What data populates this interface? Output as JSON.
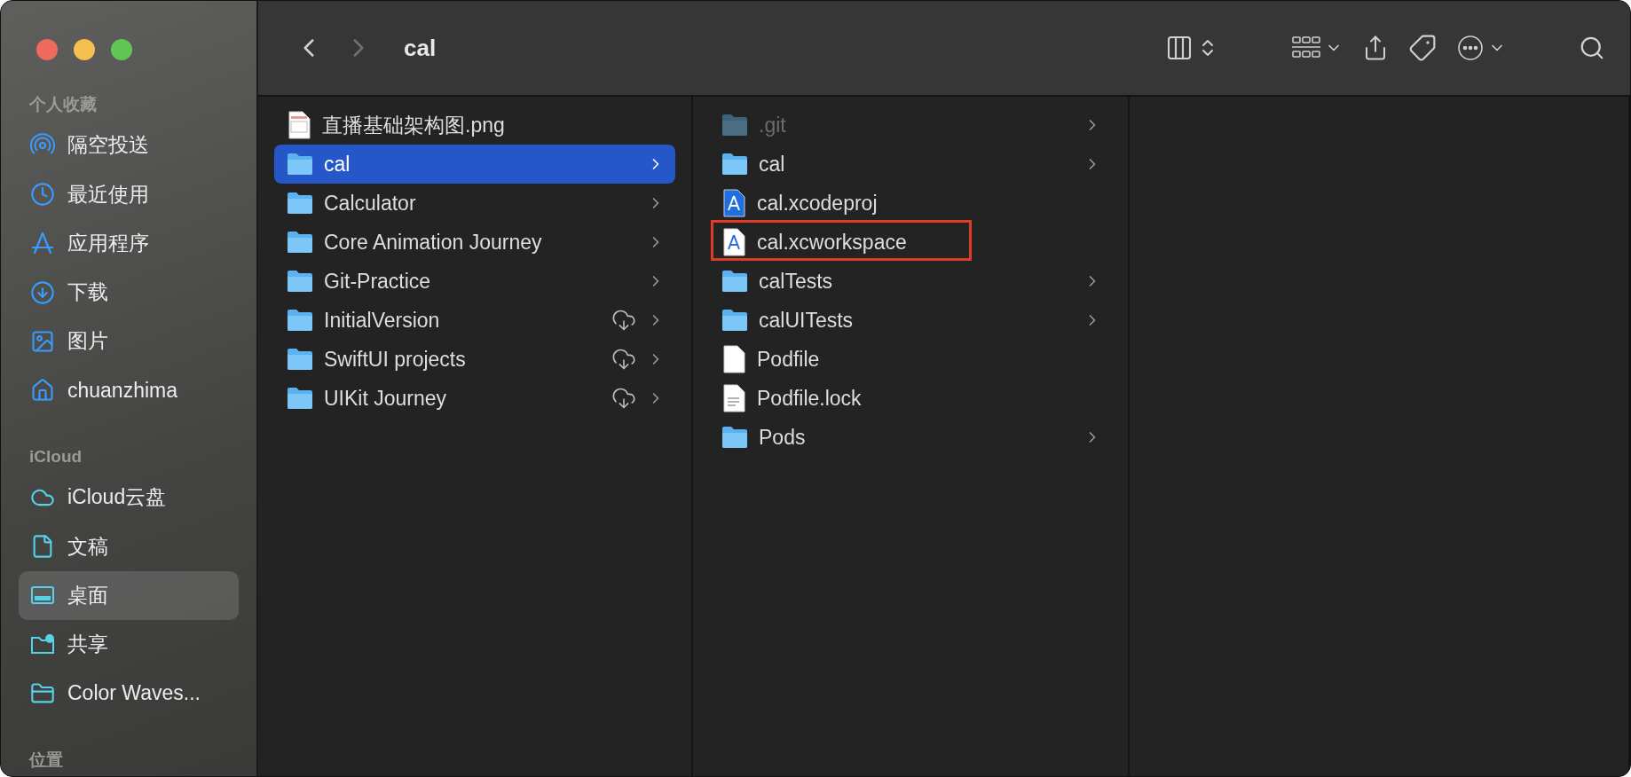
{
  "window": {
    "title": "cal"
  },
  "toolbar": {
    "back": {
      "disabled": false
    },
    "forward": {
      "disabled": true
    }
  },
  "sidebar": {
    "sections": [
      {
        "title": "个人收藏",
        "items": [
          {
            "label": "隔空投送",
            "kind": "airdrop",
            "selected": false
          },
          {
            "label": "最近使用",
            "kind": "recent",
            "selected": false
          },
          {
            "label": "应用程序",
            "kind": "apps",
            "selected": false
          },
          {
            "label": "下载",
            "kind": "download",
            "selected": false
          },
          {
            "label": "图片",
            "kind": "pictures",
            "selected": false
          },
          {
            "label": "chuanzhima",
            "kind": "home",
            "selected": false
          }
        ]
      },
      {
        "title": "iCloud",
        "items": [
          {
            "label": "iCloud云盘",
            "kind": "cloud",
            "selected": false
          },
          {
            "label": "文稿",
            "kind": "document",
            "selected": false
          },
          {
            "label": "桌面",
            "kind": "desktop",
            "selected": true
          },
          {
            "label": "共享",
            "kind": "shared",
            "selected": false
          },
          {
            "label": "Color Waves...",
            "kind": "folder",
            "selected": false
          }
        ]
      },
      {
        "title": "位置"
      }
    ]
  },
  "columns": [
    {
      "items": [
        {
          "name": "直播基础架构图.png",
          "kind": "image",
          "selected": false,
          "dimmed": false,
          "cloud": false,
          "chevron": false,
          "highlighted": false
        },
        {
          "name": "cal",
          "kind": "folder",
          "selected": true,
          "dimmed": false,
          "cloud": false,
          "chevron": true,
          "highlighted": false
        },
        {
          "name": "Calculator",
          "kind": "folder",
          "selected": false,
          "dimmed": false,
          "cloud": false,
          "chevron": true,
          "highlighted": false
        },
        {
          "name": "Core Animation Journey",
          "kind": "folder",
          "selected": false,
          "dimmed": false,
          "cloud": false,
          "chevron": true,
          "highlighted": false
        },
        {
          "name": "Git-Practice",
          "kind": "folder",
          "selected": false,
          "dimmed": false,
          "cloud": false,
          "chevron": true,
          "highlighted": false
        },
        {
          "name": "InitialVersion",
          "kind": "folder",
          "selected": false,
          "dimmed": false,
          "cloud": true,
          "chevron": true,
          "highlighted": false
        },
        {
          "name": "SwiftUI projects",
          "kind": "folder",
          "selected": false,
          "dimmed": false,
          "cloud": true,
          "chevron": true,
          "highlighted": false
        },
        {
          "name": "UIKit Journey",
          "kind": "folder",
          "selected": false,
          "dimmed": false,
          "cloud": true,
          "chevron": true,
          "highlighted": false
        }
      ]
    },
    {
      "items": [
        {
          "name": ".git",
          "kind": "folder",
          "selected": false,
          "dimmed": true,
          "cloud": false,
          "chevron": true,
          "highlighted": false
        },
        {
          "name": "cal",
          "kind": "folder",
          "selected": false,
          "dimmed": false,
          "cloud": false,
          "chevron": true,
          "highlighted": false
        },
        {
          "name": "cal.xcodeproj",
          "kind": "xcode",
          "selected": false,
          "dimmed": false,
          "cloud": false,
          "chevron": false,
          "highlighted": false
        },
        {
          "name": "cal.xcworkspace",
          "kind": "workspace",
          "selected": false,
          "dimmed": false,
          "cloud": false,
          "chevron": false,
          "highlighted": true
        },
        {
          "name": "calTests",
          "kind": "folder",
          "selected": false,
          "dimmed": false,
          "cloud": false,
          "chevron": true,
          "highlighted": false
        },
        {
          "name": "calUITests",
          "kind": "folder",
          "selected": false,
          "dimmed": false,
          "cloud": false,
          "chevron": true,
          "highlighted": false
        },
        {
          "name": "Podfile",
          "kind": "blank",
          "selected": false,
          "dimmed": false,
          "cloud": false,
          "chevron": false,
          "highlighted": false
        },
        {
          "name": "Podfile.lock",
          "kind": "text",
          "selected": false,
          "dimmed": false,
          "cloud": false,
          "chevron": false,
          "highlighted": false
        },
        {
          "name": "Pods",
          "kind": "folder",
          "selected": false,
          "dimmed": false,
          "cloud": false,
          "chevron": true,
          "highlighted": false
        }
      ]
    },
    {}
  ]
}
